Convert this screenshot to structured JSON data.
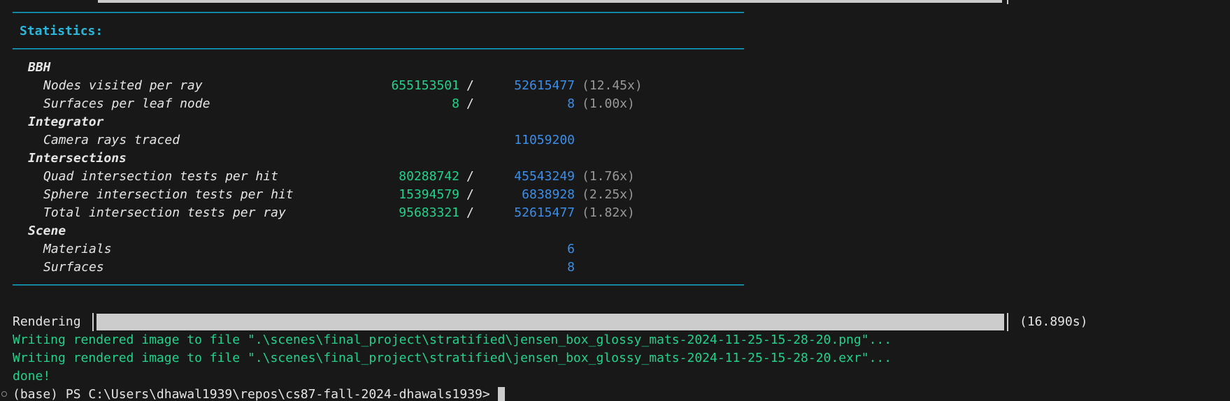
{
  "rule_text": "────────────────────────────────────────────────────────────────────────────────────────────────────────────────────────────────────────",
  "statistics_header": "Statistics:",
  "stats": {
    "bbh": {
      "label": "BBH",
      "nodes": {
        "label": "Nodes visited per ray",
        "a": "655153501",
        "sep": "/",
        "b": "52615477",
        "ratio": "(12.45x)"
      },
      "surfaces": {
        "label": "Surfaces per leaf node",
        "a": "8",
        "sep": "/",
        "b": "8",
        "ratio": "(1.00x)"
      }
    },
    "integrator": {
      "label": "Integrator",
      "camera": {
        "label": "Camera rays traced",
        "b": "11059200"
      }
    },
    "intersections": {
      "label": "Intersections",
      "quad": {
        "label": "Quad intersection tests per hit",
        "a": "80288742",
        "sep": "/",
        "b": "45543249",
        "ratio": "(1.76x)"
      },
      "sphere": {
        "label": "Sphere intersection tests per hit",
        "a": "15394579",
        "sep": "/",
        "b": "6838928",
        "ratio": "(2.25x)"
      },
      "total": {
        "label": "Total intersection tests per ray",
        "a": "95683321",
        "sep": "/",
        "b": "52615477",
        "ratio": "(1.82x)"
      }
    },
    "scene": {
      "label": "Scene",
      "materials": {
        "label": "Materials",
        "b": "6"
      },
      "surfaces": {
        "label": "Surfaces",
        "b": "8"
      }
    }
  },
  "rendering": {
    "label": "Rendering",
    "progress": 1.0,
    "time": "(16.890s)"
  },
  "output_lines": [
    "Writing rendered image to file \".\\scenes\\final_project\\stratified\\jensen_box_glossy_mats-2024-11-25-15-28-20.png\"...",
    "Writing rendered image to file \".\\scenes\\final_project\\stratified\\jensen_box_glossy_mats-2024-11-25-15-28-20.exr\"...",
    "done!"
  ],
  "prompt": "(base) PS C:\\Users\\dhawal1939\\repos\\cs87-fall-2024-dhawals1939> "
}
